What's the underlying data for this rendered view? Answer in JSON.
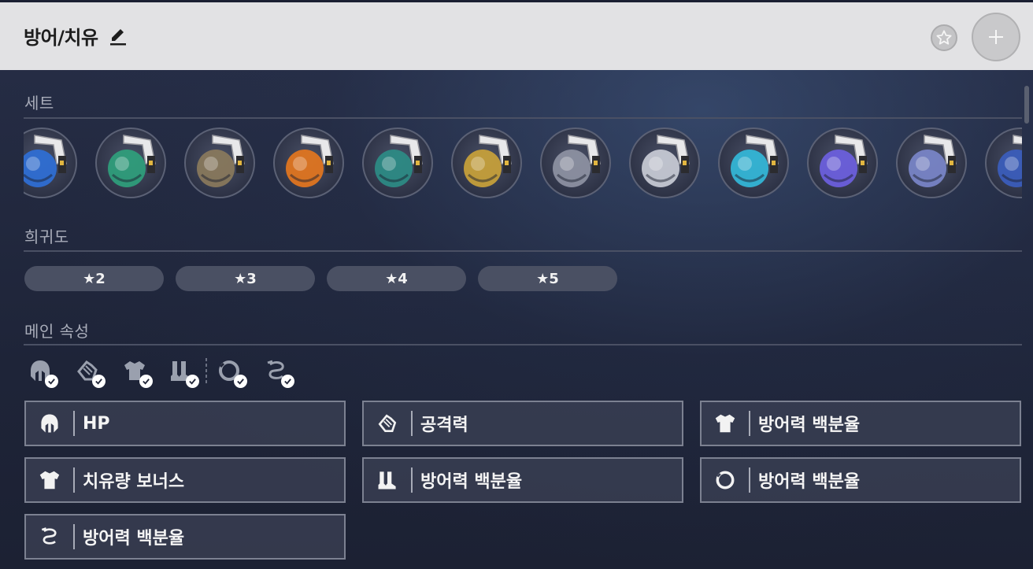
{
  "header": {
    "title": "방어/치유"
  },
  "sections": {
    "sets_label": "세트",
    "rarity_label": "희귀도",
    "main_stat_label": "메인 속성"
  },
  "sets": [
    {
      "name": "set-1",
      "color": "#2f6fd6"
    },
    {
      "name": "set-2",
      "color": "#2fa07c"
    },
    {
      "name": "set-3",
      "color": "#8a7a5c"
    },
    {
      "name": "set-4",
      "color": "#e4761e"
    },
    {
      "name": "set-5",
      "color": "#2d8c86"
    },
    {
      "name": "set-6",
      "color": "#c9a23a"
    },
    {
      "name": "set-7",
      "color": "#8e93a3"
    },
    {
      "name": "set-8",
      "color": "#c9ccd6"
    },
    {
      "name": "set-9",
      "color": "#33b8d9"
    },
    {
      "name": "set-10",
      "color": "#6d5fe0"
    },
    {
      "name": "set-11",
      "color": "#7a86c9"
    },
    {
      "name": "set-12",
      "color": "#3b5dbd"
    }
  ],
  "rarity": [
    "★2",
    "★3",
    "★4",
    "★5"
  ],
  "slot_filters": [
    {
      "icon": "head-icon",
      "checked": true
    },
    {
      "icon": "hands-icon",
      "checked": true
    },
    {
      "icon": "body-icon",
      "checked": true
    },
    {
      "icon": "feet-icon",
      "checked": true
    },
    {
      "icon": "sphere-icon",
      "checked": true
    },
    {
      "icon": "rope-icon",
      "checked": true
    }
  ],
  "main_stats": [
    {
      "icon": "head-icon",
      "label": "HP"
    },
    {
      "icon": "hands-icon",
      "label": "공격력"
    },
    {
      "icon": "body-icon",
      "label": "방어력 백분율"
    },
    {
      "icon": "body-icon",
      "label": "치유량 보너스"
    },
    {
      "icon": "feet-icon",
      "label": "방어력 백분율"
    },
    {
      "icon": "sphere-icon",
      "label": "방어력 백분율"
    },
    {
      "icon": "rope-icon",
      "label": "방어력 백분율"
    }
  ]
}
